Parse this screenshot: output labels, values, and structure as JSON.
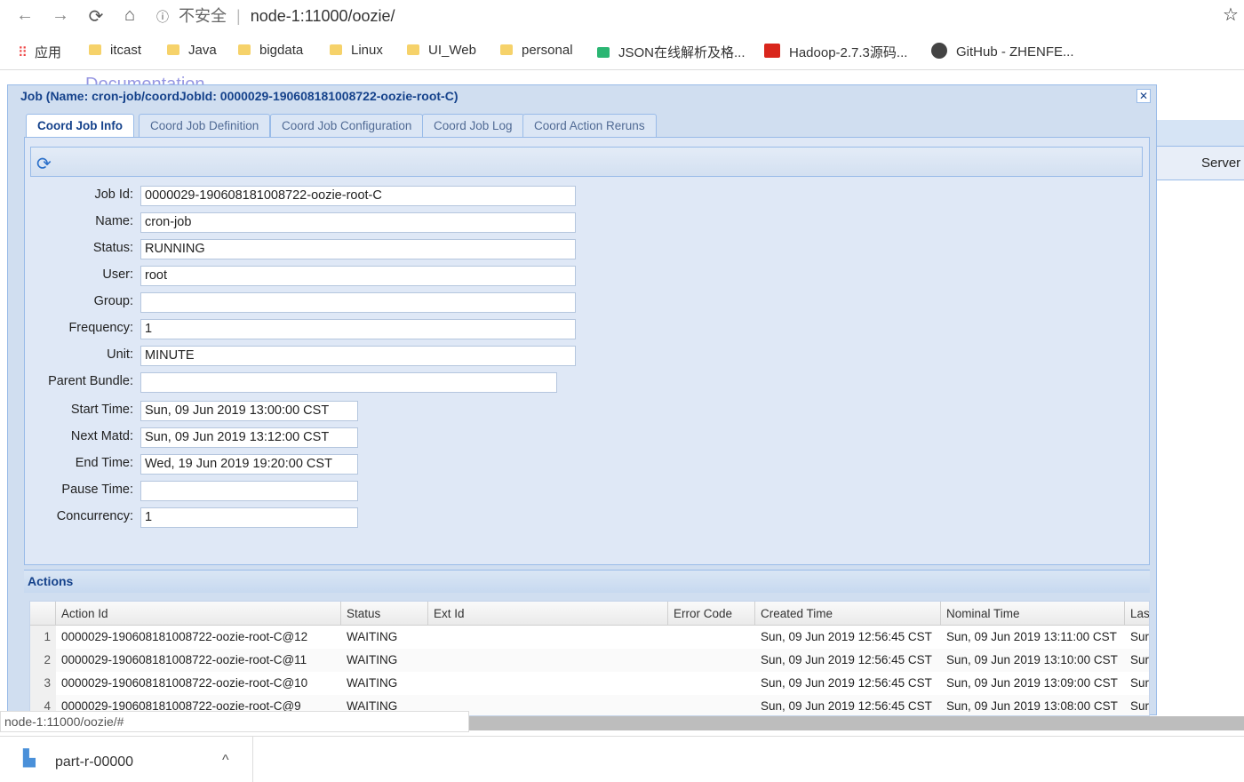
{
  "browser": {
    "back": "←",
    "forward": "→",
    "reload": "⟳",
    "home": "⌂",
    "security": "不安全",
    "url": "node-1:11000/oozie/",
    "star": "☆"
  },
  "bookmarks": [
    "应用",
    "itcast",
    "Java",
    "bigdata",
    "Linux",
    "UI_Web",
    "personal",
    "JSON在线解析及格...",
    "Hadoop-2.7.3源码...",
    "GitHub - ZHENFE..."
  ],
  "background": {
    "documentation": "Documentation",
    "server": "Server"
  },
  "window": {
    "title": "Job (Name: cron-job/coordJobId: 0000029-190608181008722-oozie-root-C)",
    "close": "✕",
    "tabs": [
      "Coord Job Info",
      "Coord Job Definition",
      "Coord Job Configuration",
      "Coord Job Log",
      "Coord Action Reruns"
    ]
  },
  "form": [
    {
      "label": "Job Id:",
      "value": "0000029-190608181008722-oozie-root-C"
    },
    {
      "label": "Name:",
      "value": "cron-job"
    },
    {
      "label": "Status:",
      "value": "RUNNING"
    },
    {
      "label": "User:",
      "value": "root"
    },
    {
      "label": "Group:",
      "value": ""
    },
    {
      "label": "Frequency:",
      "value": "1"
    },
    {
      "label": "Unit:",
      "value": "MINUTE"
    },
    {
      "label": "Parent Bundle:",
      "value": ""
    },
    {
      "label": "Start Time:",
      "value": "Sun, 09 Jun 2019 13:00:00 CST"
    },
    {
      "label": "Next Matd:",
      "value": "Sun, 09 Jun 2019 13:12:00 CST"
    },
    {
      "label": "End Time:",
      "value": "Wed, 19 Jun 2019 19:20:00 CST"
    },
    {
      "label": "Pause Time:",
      "value": ""
    },
    {
      "label": "Concurrency:",
      "value": "1"
    }
  ],
  "actions": {
    "title": "Actions",
    "columns": [
      "Action Id",
      "Status",
      "Ext Id",
      "Error Code",
      "Created Time",
      "Nominal Time",
      "Las"
    ],
    "rows": [
      [
        "1",
        "0000029-190608181008722-oozie-root-C@12",
        "WAITING",
        "",
        "",
        "Sun, 09 Jun 2019 12:56:45 CST",
        "Sun, 09 Jun 2019 13:11:00 CST",
        "Sur"
      ],
      [
        "2",
        "0000029-190608181008722-oozie-root-C@11",
        "WAITING",
        "",
        "",
        "Sun, 09 Jun 2019 12:56:45 CST",
        "Sun, 09 Jun 2019 13:10:00 CST",
        "Sur"
      ],
      [
        "3",
        "0000029-190608181008722-oozie-root-C@10",
        "WAITING",
        "",
        "",
        "Sun, 09 Jun 2019 12:56:45 CST",
        "Sun, 09 Jun 2019 13:09:00 CST",
        "Sur"
      ],
      [
        "4",
        "0000029-190608181008722-oozie-root-C@9",
        "WAITING",
        "",
        "",
        "Sun, 09 Jun 2019 12:56:45 CST",
        "Sun, 09 Jun 2019 13:08:00 CST",
        "Sur"
      ]
    ]
  },
  "statusbar": "node-1:11000/oozie/#",
  "download": {
    "file": "part-r-00000",
    "chevron": "^"
  }
}
